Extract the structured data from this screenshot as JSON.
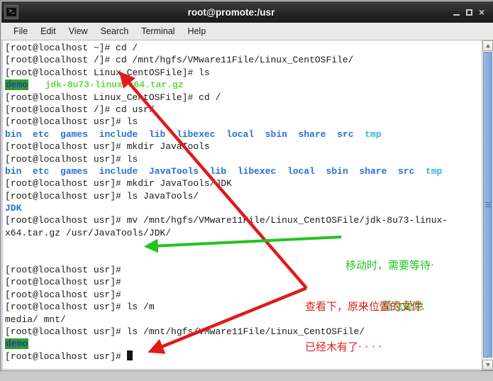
{
  "window": {
    "title": "root@promote:/usr",
    "app_icon": "terminal-icon",
    "icon_glyph": ">_",
    "buttons": {
      "minimize": "minimize-button",
      "maximize": "maximize-button",
      "close": "×"
    }
  },
  "menubar": {
    "items": [
      {
        "label": "File"
      },
      {
        "label": "Edit"
      },
      {
        "label": "View"
      },
      {
        "label": "Search"
      },
      {
        "label": "Terminal"
      },
      {
        "label": "Help"
      }
    ]
  },
  "colors": {
    "directory": "#2b6fd6",
    "sticky_dir": "#2fb6d8",
    "archive": "#69d64a",
    "demo_bg": "#2f9c2f",
    "demo_fg": "#2b3fa0",
    "annotation_green": "#22c322",
    "annotation_red": "#e01a1a",
    "terminal_bg": "#ffffff",
    "terminal_fg": "#1a1a1a"
  },
  "terminal": {
    "lines": [
      {
        "type": "cmd",
        "text": "[root@localhost ~]# cd /"
      },
      {
        "type": "cmd",
        "text": "[root@localhost /]# cd /mnt/hgfs/VMware11File/Linux_CentOSFile/"
      },
      {
        "type": "cmd",
        "text": "[root@localhost Linux_CentOSFile]# ls"
      },
      {
        "type": "ls-demo-archive",
        "demo": "demo",
        "archive": "jdk-8u73-linux-x64.tar.gz"
      },
      {
        "type": "cmd",
        "text": "[root@localhost Linux_CentOSFile]# cd /"
      },
      {
        "type": "cmd",
        "text": "[root@localhost /]# cd usr/"
      },
      {
        "type": "cmd",
        "text": "[root@localhost usr]# ls"
      },
      {
        "type": "ls-usr-1",
        "dirs": [
          "bin",
          "etc",
          "games",
          "include",
          "lib",
          "libexec",
          "local",
          "sbin",
          "share",
          "src"
        ],
        "sticky": [
          "tmp"
        ]
      },
      {
        "type": "cmd",
        "text": "[root@localhost usr]# mkdir JavaTools"
      },
      {
        "type": "cmd",
        "text": "[root@localhost usr]# ls"
      },
      {
        "type": "ls-usr-2",
        "dirs": [
          "bin",
          "etc",
          "games",
          "include",
          "JavaTools",
          "lib",
          "libexec",
          "local",
          "sbin",
          "share",
          "src"
        ],
        "sticky": [
          "tmp"
        ]
      },
      {
        "type": "cmd",
        "text": "[root@localhost usr]# mkdir JavaTools/JDK"
      },
      {
        "type": "cmd",
        "text": "[root@localhost usr]# ls JavaTools/"
      },
      {
        "type": "out-dir",
        "text": "JDK"
      },
      {
        "type": "cmd",
        "text": "[root@localhost usr]# mv /mnt/hgfs/VMware11File/Linux_CentOSFile/jdk-8u73-linux-"
      },
      {
        "type": "cmd",
        "text": "x64.tar.gz /usr/JavaTools/JDK/"
      },
      {
        "type": "blank",
        "text": ""
      },
      {
        "type": "blank",
        "text": ""
      },
      {
        "type": "cmd",
        "text": "[root@localhost usr]#"
      },
      {
        "type": "cmd",
        "text": "[root@localhost usr]#"
      },
      {
        "type": "cmd",
        "text": "[root@localhost usr]#"
      },
      {
        "type": "cmd",
        "text": "[root@localhost usr]# ls /m"
      },
      {
        "type": "plain",
        "text": "media/ mnt/"
      },
      {
        "type": "cmd",
        "text": "[root@localhost usr]# ls /mnt/hgfs/VMware11File/Linux_CentOSFile/"
      },
      {
        "type": "ls-demo-only",
        "demo": "demo"
      },
      {
        "type": "prompt-cursor",
        "text": "[root@localhost usr]# "
      }
    ]
  },
  "annotations": {
    "green_note": {
      "line1": "移动时，需要等待·",
      "line2": "· · · ·莫急莫急"
    },
    "red_note": {
      "line1": "查看下，原来位置的文件",
      "line2": "已经木有了· · · ·"
    },
    "green_arrow": "arrow-pointing-left-to-mv-output",
    "red_arrow": "double-arrow-pointing-to-archive-and-empty-listing"
  },
  "scrollbar": {
    "up": "scroll-up-button",
    "down": "scroll-down-button",
    "thumb": "scroll-thumb"
  }
}
